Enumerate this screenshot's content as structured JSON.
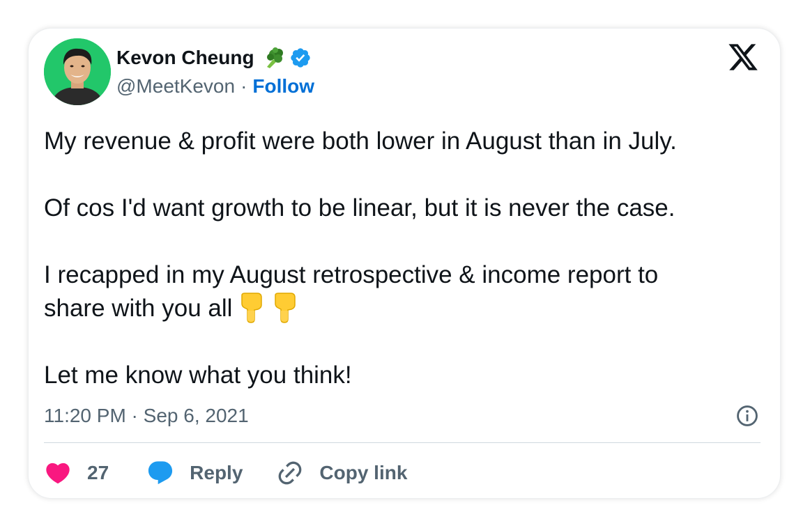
{
  "author": {
    "name": "Kevon Cheung",
    "handle": "@MeetKevon",
    "separator": "·",
    "follow_label": "Follow",
    "emoji_icon": "broccoli-icon",
    "verified_icon": "verified-badge-icon"
  },
  "tweet": {
    "paragraphs": [
      "My revenue & profit were both lower in August than in July.",
      "Of cos I'd want growth to be linear, but it is never the case.",
      "I recapped in my August retrospective & income report to",
      "share with you all",
      "Let me know what you think!"
    ],
    "inline_emojis": [
      "backhand-index-pointing-down-icon",
      "backhand-index-pointing-down-icon"
    ]
  },
  "timestamp": "11:20 PM · Sep 6, 2021",
  "actions": {
    "like_count": "27",
    "reply_label": "Reply",
    "copy_link_label": "Copy link"
  },
  "colors": {
    "follow_blue": "#006fd6",
    "verified_blue": "#1d9bf0",
    "like_pink": "#f91880",
    "text_dark": "#0f1419",
    "text_gray": "#536471",
    "avatar_bg": "#22c76a"
  }
}
